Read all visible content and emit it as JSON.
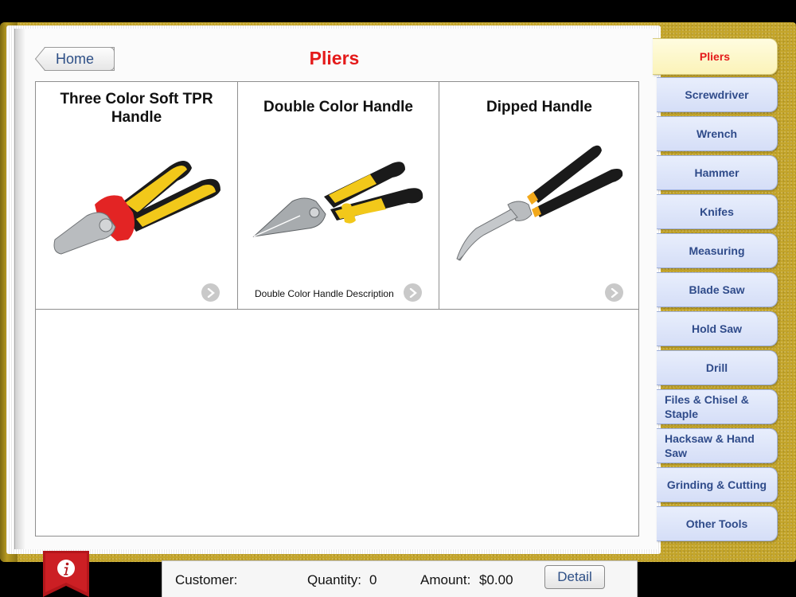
{
  "header": {
    "home_label": "Home",
    "title": "Pliers"
  },
  "products": [
    {
      "title": "Three Color Soft TPR Handle",
      "description": "",
      "icon": "combination-pliers-icon"
    },
    {
      "title": "Double Color Handle",
      "description": "Double Color Handle Description",
      "icon": "diagonal-cutter-icon"
    },
    {
      "title": "Dipped Handle",
      "description": "",
      "icon": "bent-nose-pliers-icon"
    }
  ],
  "tabs": [
    {
      "label": "Pliers",
      "active": true
    },
    {
      "label": "Screwdriver"
    },
    {
      "label": "Wrench"
    },
    {
      "label": "Hammer"
    },
    {
      "label": "Knifes"
    },
    {
      "label": "Measuring"
    },
    {
      "label": "Blade Saw"
    },
    {
      "label": "Hold Saw"
    },
    {
      "label": "Drill"
    },
    {
      "label": "Files & Chisel & Staple"
    },
    {
      "label": "Hacksaw & Hand Saw"
    },
    {
      "label": "Grinding & Cutting"
    },
    {
      "label": "Other Tools"
    }
  ],
  "footer": {
    "customer_label": "Customer:",
    "quantity_label": "Quantity:",
    "quantity_value": "0",
    "amount_label": "Amount:",
    "amount_value": "$0.00",
    "detail_label": "Detail",
    "info_icon": "info-icon"
  },
  "colors": {
    "title_red": "#e41a1a",
    "tab_text": "#2f4b8a",
    "cover_gold": "#c4a52a"
  }
}
